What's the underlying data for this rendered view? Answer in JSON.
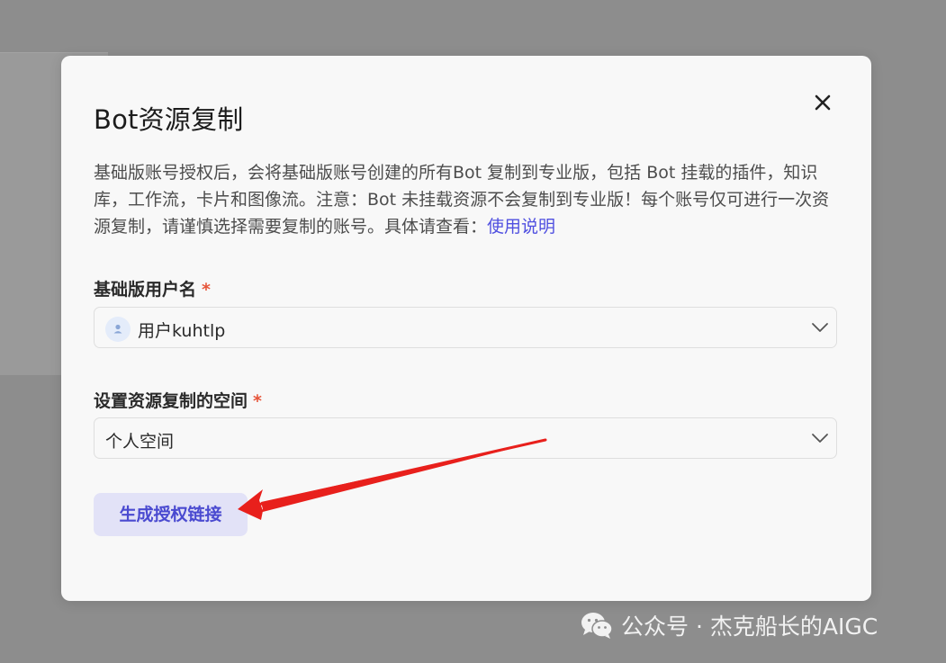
{
  "dialog": {
    "title": "Bot资源复制",
    "description": "基础版账号授权后，会将基础版账号创建的所有Bot 复制到专业版，包括 Bot 挂载的插件，知识库，工作流，卡片和图像流。注意：Bot 未挂载资源不会复制到专业版！每个账号仅可进行一次资源复制，请谨慎选择需要复制的账号。具体请查看：",
    "help_link": "使用说明",
    "close_icon": "close-icon"
  },
  "form": {
    "username": {
      "label": "基础版用户名",
      "required_mark": "*",
      "value": "用户kuhtlp",
      "icon": "user-avatar-icon"
    },
    "space": {
      "label": "设置资源复制的空间",
      "required_mark": "*",
      "value": "个人空间"
    },
    "submit_label": "生成授权链接"
  },
  "watermark": {
    "text": "公众号 · 杰克船长的AIGC",
    "icon": "wechat-icon"
  },
  "colors": {
    "accent": "#4f4fe0",
    "button_bg": "#e2e2f7",
    "required": "#e6553a",
    "annotation_arrow": "#e8201c"
  }
}
